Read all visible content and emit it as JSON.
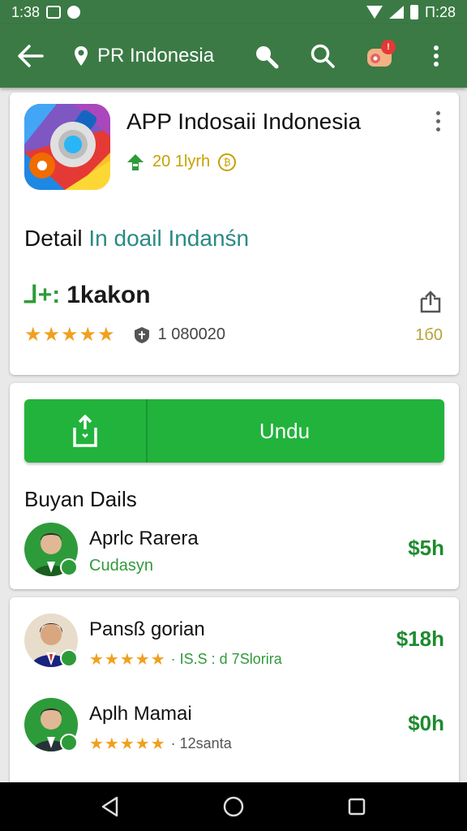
{
  "status_bar": {
    "time_left": "1:38",
    "time_right": "Π:28"
  },
  "appbar": {
    "title": "PR Indonesia",
    "notification_count": "!",
    "icons": [
      "back-arrow-icon",
      "location-pin-icon",
      "search-zoom-icon",
      "search-icon",
      "notification-icon",
      "more-vert-icon"
    ]
  },
  "app_card": {
    "app_name": "APP Indosaii Indonesia",
    "meta_value": "20 1lyrh",
    "detail_label": "Detail",
    "detail_value": "In doail Indanśn",
    "sub_mark": "⅃+:",
    "sub_title": "1kakon",
    "stars": "★★★★★",
    "reviews": "1 080020",
    "side_count": "1б0"
  },
  "download": {
    "label": "Undu"
  },
  "buyer_section": {
    "title": "Buyan Dails",
    "items": [
      {
        "name": "Aprlc Rarera",
        "sub": "Cudasyn",
        "price": "$5h"
      }
    ]
  },
  "list": {
    "items": [
      {
        "name": "Pansß gorian",
        "stars": "★★★★★",
        "rating": "· IS.S : d 7Slorira",
        "price": "$18h"
      },
      {
        "name": "Aplh Mamai",
        "stars": "★★★★★",
        "rating": "· 12santa",
        "price": "$0h"
      }
    ]
  },
  "colors": {
    "appbar": "#3b7a45",
    "download_button": "#22b33c",
    "accent_green": "#2e9b3a",
    "star": "#f0a020",
    "teal": "#2a8a84"
  }
}
